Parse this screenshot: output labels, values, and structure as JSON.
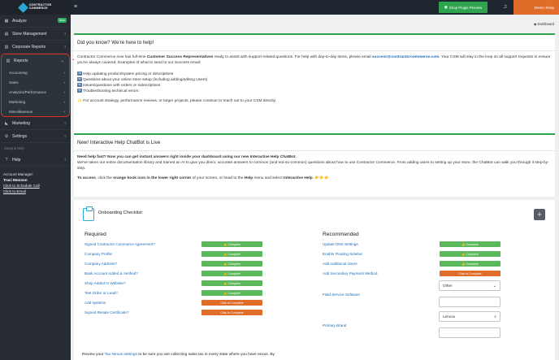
{
  "sidebar": {
    "logo_line1": "CONTRACTOR",
    "logo_line2": "COMMERCE",
    "items": [
      {
        "label": "Analyze",
        "icon": "chart-icon",
        "badge": "New"
      },
      {
        "label": "Store Management",
        "icon": "store-icon"
      },
      {
        "label": "Corporate Reports",
        "icon": "report-icon"
      }
    ],
    "reports": {
      "label": "Reports",
      "icon": "report-icon",
      "sub": [
        "Accounting",
        "Sales",
        "Analytics/Performance",
        "Marketing",
        "Miscellaneous"
      ]
    },
    "items2": [
      {
        "label": "Marketing",
        "icon": "megaphone-icon"
      },
      {
        "label": "Settings",
        "icon": "gear-icon"
      }
    ],
    "setup_label": "Setup & Help",
    "help": {
      "label": "Help",
      "icon": "help-icon"
    },
    "account": {
      "title": "Account Manager:",
      "name": "Traci Monson",
      "schedule": "Click to Schedule Call",
      "email": "Click to Email"
    }
  },
  "topbar": {
    "preview_label": "Shop Plugin Preview",
    "demo_label": "Demo Shop"
  },
  "breadcrumb": "Dashboard",
  "panel1": {
    "title": "Did you know? We're here to help!",
    "intro_a": "Contractor Commerce now has full-time ",
    "intro_b": "Customer Success Representatives",
    "intro_c": " ready to assist with support-related questions. For help with day-to-day items, please email ",
    "email": "success@contractorcommerce.com",
    "intro_d": ". Your CSM will stay in the loop on all support requests to ensure you're always covered. Examples of what to send to our Success email:",
    "bullets": [
      "Help updating product/system pricing or descriptions",
      "Questions about your online store setup (including adding/editing Users)",
      "Issues/questions with orders or subscriptions",
      "Troubleshooting technical errors"
    ],
    "bullet_glyph": "➡",
    "closing": "✨ For account strategy, performance reviews, or larger projects, please continue to reach out to your CSM directly."
  },
  "panel2": {
    "title": "New! Interactive Help ChatBot is Live",
    "lead": "Need help fast? Now you can get instant answers right inside your dashboard using our new Interactive Help ChatBot.",
    "para": "We've taken our entire documentation library and trained an AI to give you direct, accurate answers to common (and not-so-common) questions about how to use Contractor Commerce. From adding users to setting up your store, the ChatBot can walk you through it step-by-step.",
    "access_a": "To access",
    "access_b": ", click the ",
    "access_c": "orange book icon in the lower right corner",
    "access_d": " of your screen, or head to the ",
    "access_e": "Help",
    "access_f": " menu and select ",
    "access_g": "Interactive Help",
    "access_h": ". 👉👉👉"
  },
  "checklist": {
    "title": "Onboarding Checklist:",
    "plus": "+",
    "required_title": "Required",
    "recommended_title": "Recommended",
    "complete_label": "👍 Complete",
    "click_label": "Click to Complete",
    "required": [
      {
        "label": "Signed Contractor Commerce Agreement?",
        "status": "complete"
      },
      {
        "label": "Company Profile",
        "status": "complete"
      },
      {
        "label": "Company Address?",
        "status": "complete"
      },
      {
        "label": "Bank Account Added & Verified?",
        "status": "complete"
      },
      {
        "label": "Shop Added to Website?",
        "status": "complete"
      },
      {
        "label": "Test Order or Lead?",
        "status": "complete"
      },
      {
        "label": "Add systems",
        "status": "incomplete"
      },
      {
        "label": "Signed Resale Certificate?",
        "status": "incomplete"
      }
    ],
    "recommended": [
      {
        "label": "Update DNS Settings",
        "status": "complete"
      },
      {
        "label": "Enable Floating Sidebar",
        "status": "complete"
      },
      {
        "label": "Add Additional Users",
        "status": "complete"
      },
      {
        "label": "Add Secondary Payment Method",
        "status": "incomplete"
      }
    ],
    "select_value": "Other",
    "field_service_label": "Field Service Software",
    "search_value": "Lennox",
    "primary_brand_label": "Primary Brand",
    "footnote_a": "Review your ",
    "footnote_link": "Tax Nexus settings",
    "footnote_b": " to be sure you are collecting sales tax in every state where you have nexus. By"
  },
  "colors": {
    "accent_green": "#2ea44f",
    "orange": "#e06c2a",
    "highlight_red": "#e0301e",
    "link_blue": "#1e6bb8"
  }
}
